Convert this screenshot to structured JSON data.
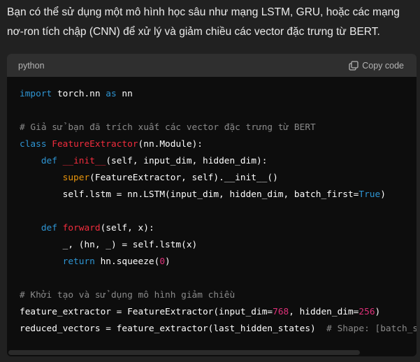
{
  "message": {
    "text": "Bạn có thể sử dụng một mô hình học sâu như mạng LSTM, GRU, hoặc các mạng nơ-ron tích chập (CNN) để xử lý và giảm chiều các vector đặc trưng từ BERT."
  },
  "code_block": {
    "language": "python",
    "copy_label": "Copy code",
    "copy_icon": "copy-icon",
    "lines": [
      [
        [
          "import",
          "kw"
        ],
        [
          " torch.nn ",
          ""
        ],
        [
          "as",
          "kw"
        ],
        [
          " nn",
          ""
        ]
      ],
      [],
      [
        [
          "# Giả sử bạn đã trích xuất các vector đặc trưng từ BERT",
          "cm"
        ]
      ],
      [
        [
          "class",
          "kw"
        ],
        [
          " ",
          ""
        ],
        [
          "FeatureExtractor",
          "fn"
        ],
        [
          "(nn.Module):",
          ""
        ]
      ],
      [
        [
          "    ",
          ""
        ],
        [
          "def",
          "kw"
        ],
        [
          " ",
          ""
        ],
        [
          "__init__",
          "fn"
        ],
        [
          "(self, input_dim, hidden_dim):",
          ""
        ]
      ],
      [
        [
          "        ",
          ""
        ],
        [
          "super",
          "bi"
        ],
        [
          "(FeatureExtractor, self).__init__()",
          ""
        ]
      ],
      [
        [
          "        self.lstm = nn.LSTM(input_dim, hidden_dim, batch_first=",
          ""
        ],
        [
          "True",
          "kw"
        ],
        [
          ")",
          ""
        ]
      ],
      [],
      [
        [
          "    ",
          ""
        ],
        [
          "def",
          "kw"
        ],
        [
          " ",
          ""
        ],
        [
          "forward",
          "fn"
        ],
        [
          "(self, x):",
          ""
        ]
      ],
      [
        [
          "        _, (hn, _) = self.lstm(x)",
          ""
        ]
      ],
      [
        [
          "        ",
          ""
        ],
        [
          "return",
          "kw"
        ],
        [
          " hn.squeeze(",
          ""
        ],
        [
          "0",
          "num"
        ],
        [
          ")",
          ""
        ]
      ],
      [],
      [
        [
          "# Khởi tạo và sử dụng mô hình giảm chiều",
          "cm"
        ]
      ],
      [
        [
          "feature_extractor = FeatureExtractor(input_dim=",
          ""
        ],
        [
          "768",
          "num"
        ],
        [
          ", hidden_dim=",
          ""
        ],
        [
          "256",
          "num"
        ],
        [
          ")",
          ""
        ]
      ],
      [
        [
          "reduced_vectors = feature_extractor(last_hidden_states)  ",
          ""
        ],
        [
          "# Shape: [batch_size, hidden_dim]",
          "cm"
        ]
      ]
    ]
  }
}
